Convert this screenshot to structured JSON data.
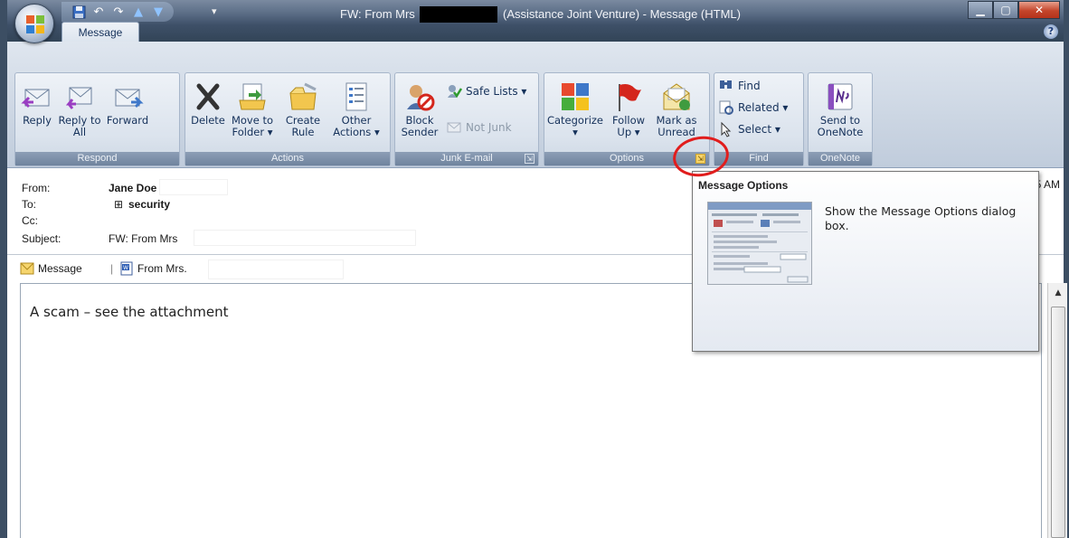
{
  "window": {
    "title_prefix": "FW: From Mrs",
    "title_suffix": "(Assistance Joint Venture) - Message (HTML)"
  },
  "tabs": {
    "message": "Message"
  },
  "ribbon": {
    "respond": {
      "label": "Respond",
      "reply": "Reply",
      "reply_all": "Reply to All",
      "forward": "Forward"
    },
    "actions": {
      "label": "Actions",
      "delete": "Delete",
      "move_to_folder": "Move to Folder ▾",
      "create_rule": "Create Rule",
      "other_actions": "Other Actions ▾"
    },
    "junk": {
      "label": "Junk E-mail",
      "block_sender": "Block Sender",
      "safe_lists": "Safe Lists ▾",
      "not_junk": "Not Junk"
    },
    "options": {
      "label": "Options",
      "categorize": "Categorize ▾",
      "follow_up": "Follow Up ▾",
      "mark_as_unread": "Mark as Unread"
    },
    "find": {
      "label": "Find",
      "find": "Find",
      "related": "Related ▾",
      "select": "Select ▾"
    },
    "onenote": {
      "label": "OneNote",
      "send_to_onenote": "Send to OneNote"
    }
  },
  "header": {
    "from_label": "From:",
    "from_value": "Jane Doe",
    "to_label": "To:",
    "to_value": "security",
    "cc_label": "Cc:",
    "subject_label": "Subject:",
    "subject_value": "FW: From Mrs",
    "sent_partial": "5 AM"
  },
  "attachments": {
    "message": "Message",
    "file": "From Mrs."
  },
  "body": {
    "text": "A scam – see the attachment"
  },
  "tooltip": {
    "title": "Message Options",
    "description": "Show the Message Options dialog box."
  },
  "icons": [
    "office-button-icon",
    "save-icon",
    "undo-icon",
    "redo-icon",
    "up-arrow-icon",
    "down-arrow-icon",
    "help-icon",
    "reply-icon",
    "reply-all-icon",
    "forward-icon",
    "delete-icon",
    "move-to-folder-icon",
    "create-rule-icon",
    "other-actions-icon",
    "block-sender-icon",
    "safe-lists-icon",
    "not-junk-icon",
    "categorize-icon",
    "follow-up-icon",
    "mark-as-unread-icon",
    "find-icon",
    "related-icon",
    "select-icon",
    "onenote-icon",
    "envelope-icon",
    "word-document-icon"
  ],
  "colors": {
    "annotation": "#e11d1d",
    "ribbon": "#dbe3ed",
    "titlebar": "#3e5068"
  }
}
